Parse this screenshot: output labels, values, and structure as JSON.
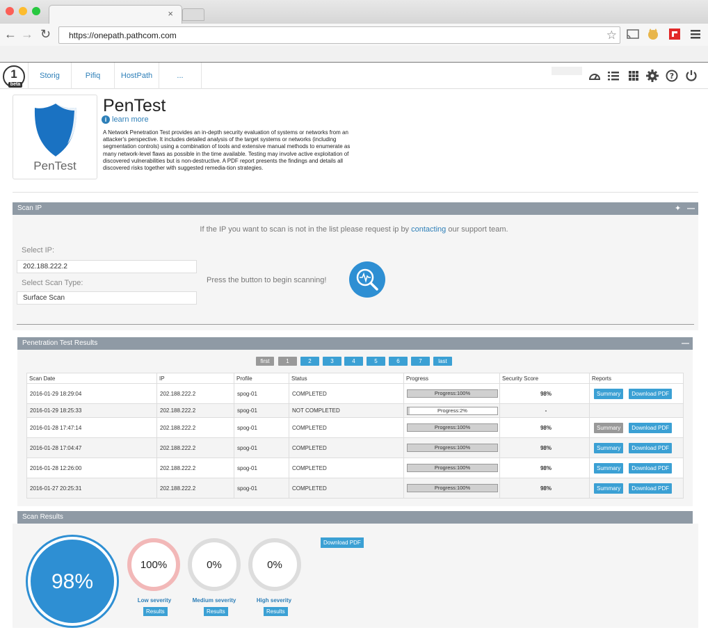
{
  "browser": {
    "url": "https://onepath.pathcom.com",
    "close_tab": "×"
  },
  "app_nav": {
    "logo_number": "1",
    "logo_badge": "beta",
    "items": [
      "Storig",
      "Pifiq",
      "HostPath",
      "..."
    ]
  },
  "product": {
    "logo_label": "PenTest",
    "title": "PenTest",
    "learn_more": "learn more",
    "description": "A Network Penetration Test provides an in-depth security evaluation of systems or networks from an attacker's perspective. It includes detailed analysis of the target systems or networks (including segmentation controls) using a combination of tools and extensive manual methods to enumerate as many network-level flaws as possible in the time available. Testing may involve active exploitation of discovered vulnerabilities but is non-destructive. A PDF report presents the findings and details all discovered risks together with suggested remedia-tion strategies."
  },
  "scan_ip": {
    "header": "Scan IP",
    "hint_before": "If the IP you want to scan is not in the list please request ip by ",
    "hint_link": "contacting",
    "hint_after": " our support team.",
    "select_ip_label": "Select IP:",
    "select_ip_value": "202.188.222.2",
    "scan_type_label": "Select Scan Type:",
    "scan_type_value": "Surface Scan",
    "press_text": "Press the button to begin scanning!"
  },
  "results_panel": {
    "header": "Penetration Test Results",
    "pagination": [
      "first",
      "1",
      "2",
      "3",
      "4",
      "5",
      "6",
      "7",
      "last"
    ],
    "columns": [
      "Scan Date",
      "IP",
      "Profile",
      "Status",
      "Progress",
      "Security Score",
      "Reports"
    ],
    "summary_label": "Summary",
    "download_label": "Download PDF",
    "rows": [
      {
        "date": "2016-01-29 18:29:04",
        "ip": "202.188.222.2",
        "profile": "spog-01",
        "status": "COMPLETED",
        "progress": 100,
        "progress_text": "Progress:100%",
        "score": "98%",
        "reports": true
      },
      {
        "date": "2016-01-29 18:25:33",
        "ip": "202.188.222.2",
        "profile": "spog-01",
        "status": "NOT COMPLETED",
        "progress": 2,
        "progress_text": "Progress:2%",
        "score": "-",
        "reports": false
      },
      {
        "date": "2016-01-28 17:47:14",
        "ip": "202.188.222.2",
        "profile": "spog-01",
        "status": "COMPLETED",
        "progress": 100,
        "progress_text": "Progress:100%",
        "score": "98%",
        "reports": true
      },
      {
        "date": "2016-01-28 17:04:47",
        "ip": "202.188.222.2",
        "profile": "spog-01",
        "status": "COMPLETED",
        "progress": 100,
        "progress_text": "Progress:100%",
        "score": "98%",
        "reports": true
      },
      {
        "date": "2016-01-28 12:26:00",
        "ip": "202.188.222.2",
        "profile": "spog-01",
        "status": "COMPLETED",
        "progress": 100,
        "progress_text": "Progress:100%",
        "score": "98%",
        "reports": true
      },
      {
        "date": "2016-01-27 20:25:31",
        "ip": "202.188.222.2",
        "profile": "spog-01",
        "status": "COMPLETED",
        "progress": 100,
        "progress_text": "Progress:100%",
        "score": "98%",
        "reports": true
      }
    ]
  },
  "scan_results": {
    "header": "Scan Results",
    "overall": "98%",
    "download_label": "Download PDF",
    "results_label": "Results",
    "severities": [
      {
        "label": "Low severity",
        "value": "100%",
        "color": "#f2b8b8"
      },
      {
        "label": "Medium severity",
        "value": "0%",
        "color": "#dddddd"
      },
      {
        "label": "High severity",
        "value": "0%",
        "color": "#dddddd"
      }
    ]
  },
  "colors": {
    "accent": "#2e8fd3",
    "button": "#3ba0d4",
    "panel_header": "#8f9aa5"
  }
}
